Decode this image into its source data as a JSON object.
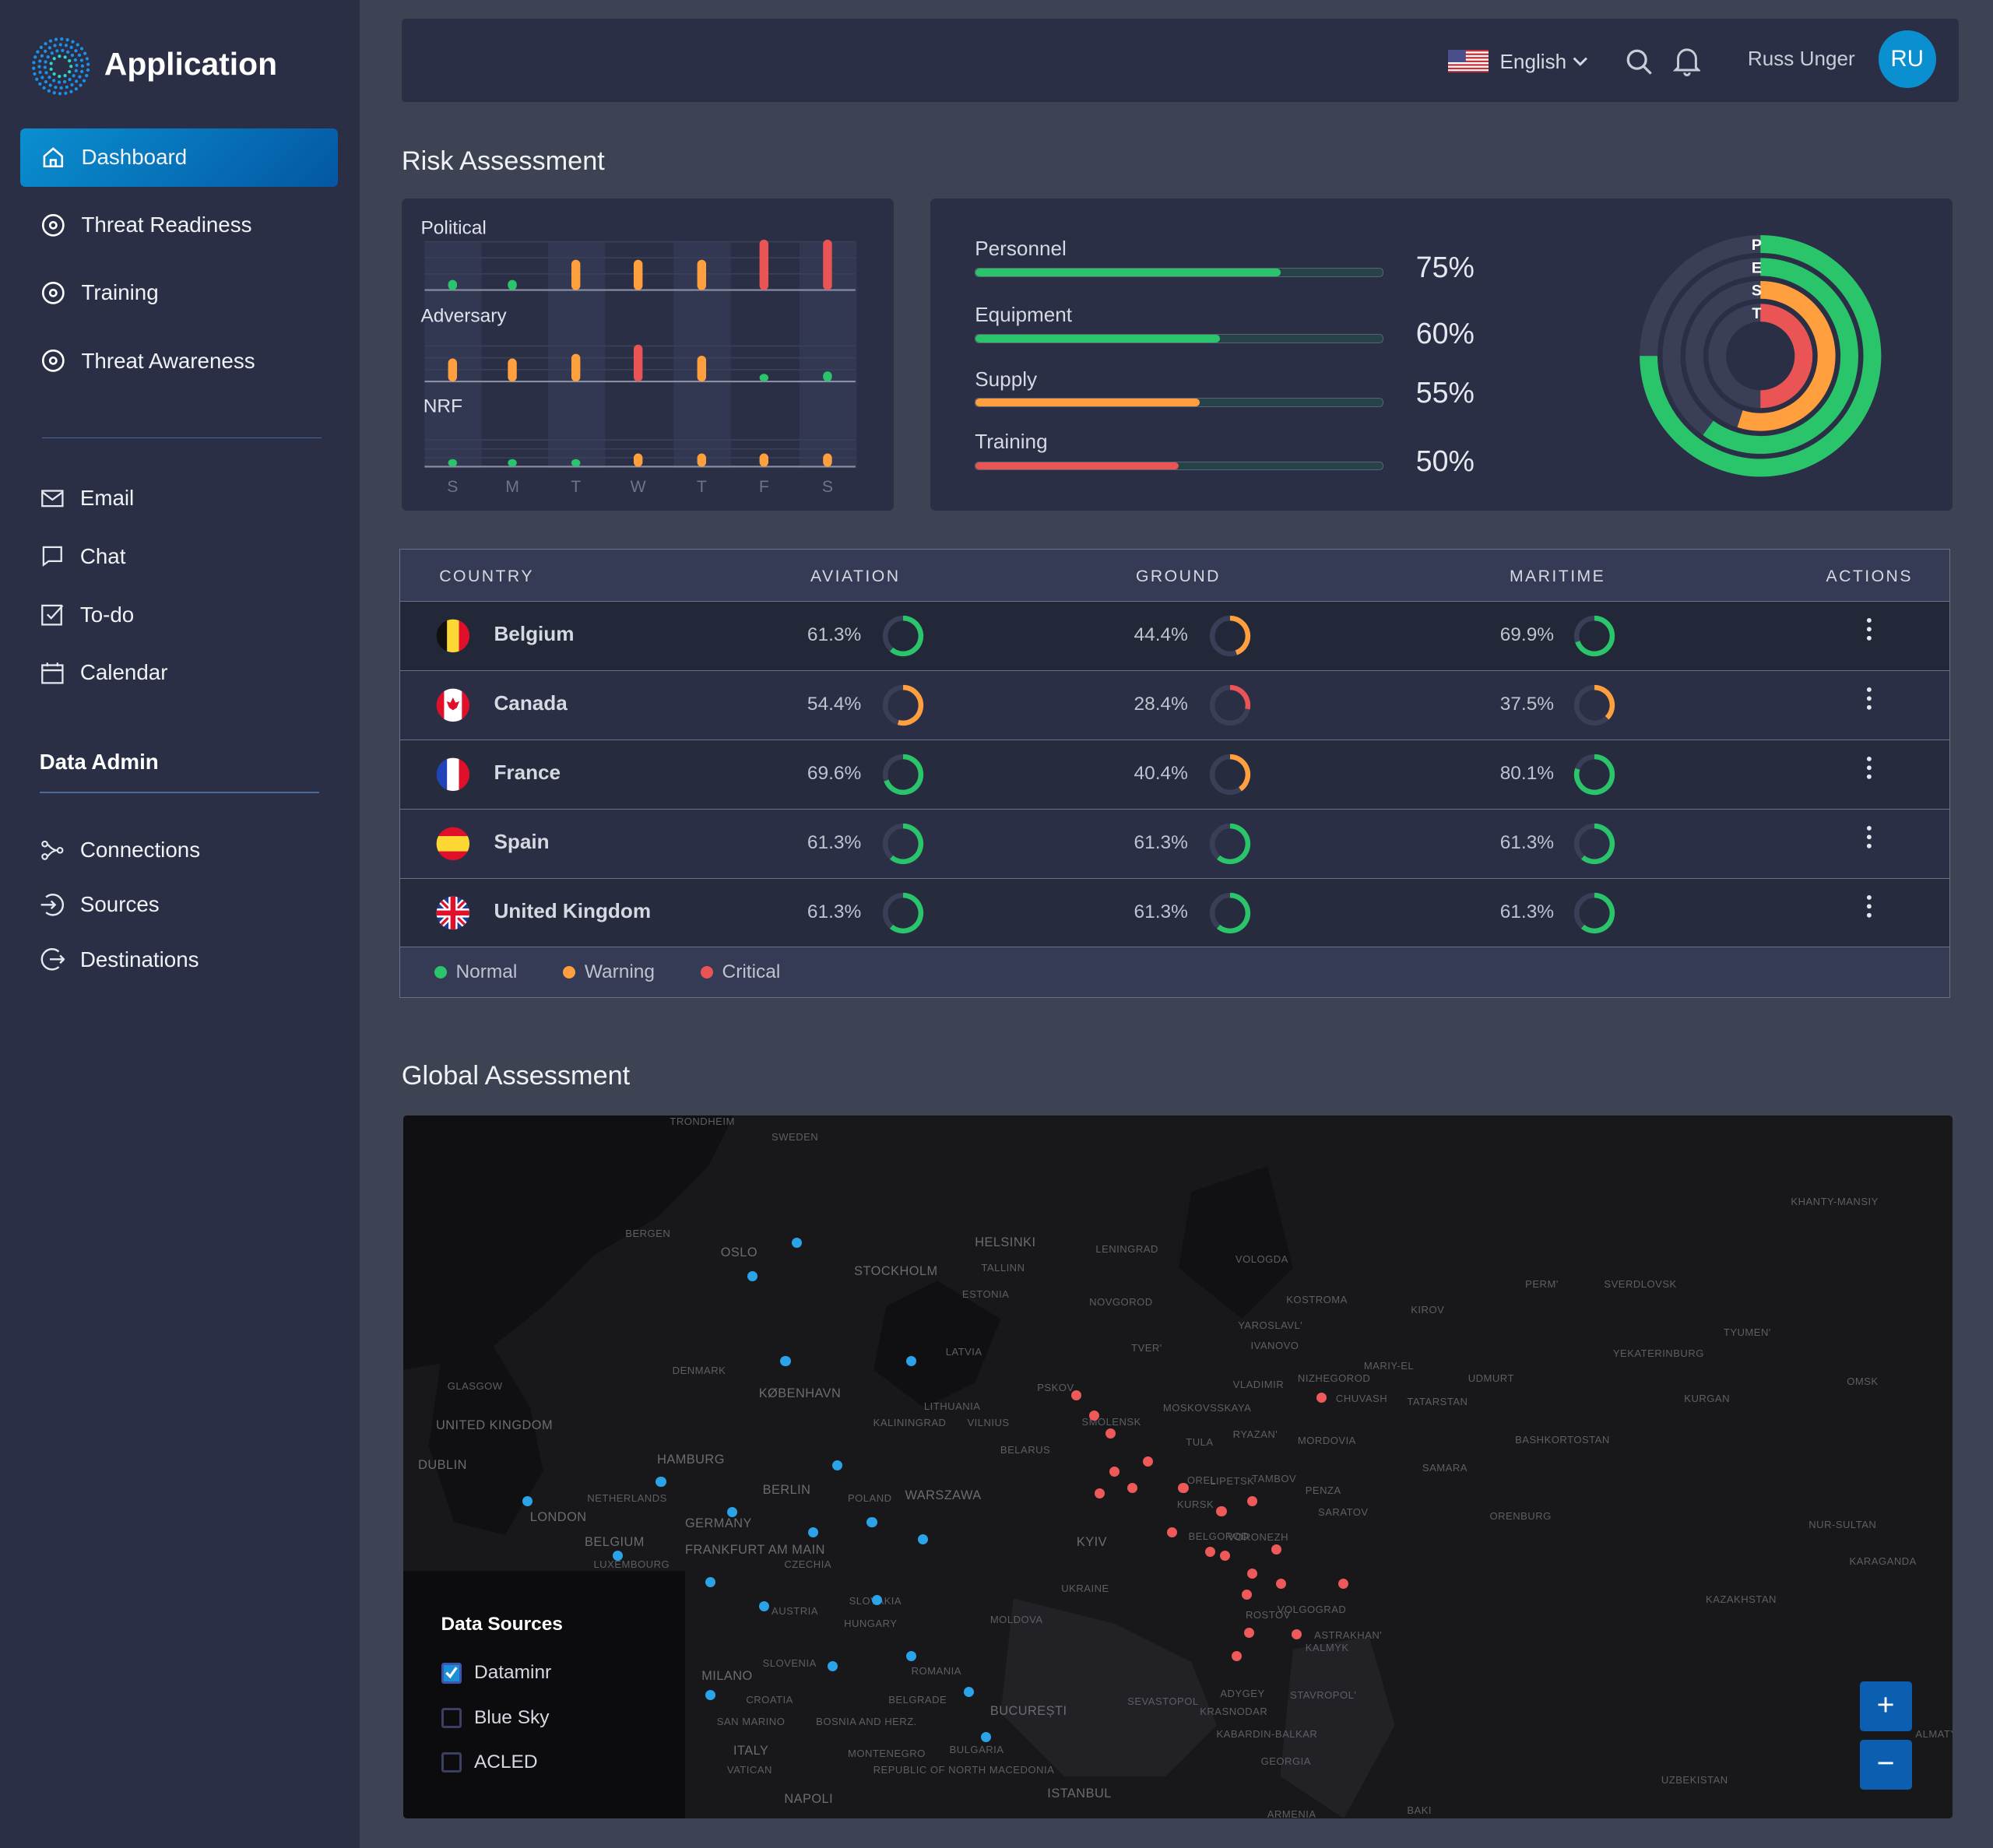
{
  "app": {
    "title": "Application",
    "logo": "dotted-ring-logo"
  },
  "sidebar": {
    "primary": [
      {
        "label": "Dashboard",
        "icon": "home-icon",
        "active": true
      },
      {
        "label": "Threat Readiness",
        "icon": "target-icon"
      },
      {
        "label": "Training",
        "icon": "target-icon"
      },
      {
        "label": "Threat Awareness",
        "icon": "target-icon"
      }
    ],
    "secondary": [
      {
        "label": "Email",
        "icon": "mail-icon"
      },
      {
        "label": "Chat",
        "icon": "chat-icon"
      },
      {
        "label": "To-do",
        "icon": "checkbox-icon"
      },
      {
        "label": "Calendar",
        "icon": "calendar-icon"
      }
    ],
    "data_admin_title": "Data Admin",
    "data_admin": [
      {
        "label": "Connections",
        "icon": "connections-icon"
      },
      {
        "label": "Sources",
        "icon": "sources-icon"
      },
      {
        "label": "Destinations",
        "icon": "destinations-icon"
      }
    ]
  },
  "header": {
    "language": "English",
    "user_name": "Russ Unger",
    "avatar_initials": "RU",
    "accent": "#0a8fd0"
  },
  "risk": {
    "title": "Risk Assessment",
    "days": [
      "S",
      "M",
      "T",
      "W",
      "T",
      "F",
      "S"
    ],
    "mini_charts": [
      {
        "label": "Political",
        "values": [
          1,
          1,
          3,
          3,
          3,
          5,
          5
        ]
      },
      {
        "label": "Adversary",
        "values": [
          2.5,
          2.5,
          3,
          4,
          2.8,
          0.8,
          1.1
        ]
      },
      {
        "label": "NRF",
        "values": [
          1,
          0.8,
          0.8,
          2,
          2,
          2,
          2
        ]
      }
    ],
    "readiness": [
      {
        "label": "Personnel",
        "value": 75,
        "pct": "75%",
        "color": "#2ac56b"
      },
      {
        "label": "Equipment",
        "value": 60,
        "pct": "60%",
        "color": "#2ac56b"
      },
      {
        "label": "Supply",
        "value": 55,
        "pct": "55%",
        "color": "#ff9f3d"
      },
      {
        "label": "Training",
        "value": 50,
        "pct": "50%",
        "color": "#ea5455"
      }
    ],
    "pest": [
      {
        "letter": "P",
        "value": 75,
        "color": "#2ac56b"
      },
      {
        "letter": "E",
        "value": 60,
        "color": "#2ac56b"
      },
      {
        "letter": "S",
        "value": 55,
        "color": "#ff9f3d"
      },
      {
        "letter": "T",
        "value": 50,
        "color": "#ea5455"
      }
    ]
  },
  "table": {
    "headers": [
      "COUNTRY",
      "AVIATION",
      "GROUND",
      "MARITIME",
      "ACTIONS"
    ],
    "rows": [
      {
        "country": "Belgium",
        "flag": "belgium-flag",
        "aviation": "61.3%",
        "ground": "44.4%",
        "maritime": "69.9%"
      },
      {
        "country": "Canada",
        "flag": "canada-flag",
        "aviation": "54.4%",
        "ground": "28.4%",
        "maritime": "37.5%"
      },
      {
        "country": "France",
        "flag": "france-flag",
        "aviation": "69.6%",
        "ground": "40.4%",
        "maritime": "80.1%"
      },
      {
        "country": "Spain",
        "flag": "spain-flag",
        "aviation": "61.3%",
        "ground": "61.3%",
        "maritime": "61.3%"
      },
      {
        "country": "United Kingdom",
        "flag": "uk-flag",
        "aviation": "61.3%",
        "ground": "61.3%",
        "maritime": "61.3%"
      }
    ],
    "legend": [
      {
        "label": "Normal",
        "color": "#2ac56b"
      },
      {
        "label": "Warning",
        "color": "#ff9f3d"
      },
      {
        "label": "Critical",
        "color": "#ea5455"
      }
    ]
  },
  "global": {
    "title": "Global Assessment",
    "map_labels": [
      "TRONDHEIM",
      "SWEDEN",
      "BERGEN",
      "OSLO",
      "STOCKHOLM",
      "HELSINKI",
      "TALLINN",
      "ESTONIA",
      "LENINGRAD",
      "NOVGOROD",
      "VOLOGDA",
      "KOSTROMA",
      "KIROV",
      "PERM'",
      "SVERDLOVSK",
      "KHANTY-MANSIY",
      "TVER'",
      "YAROSLAVL'",
      "IVANOVO",
      "LATVIA",
      "DENMARK",
      "KØBENHAVN",
      "GLASGOW",
      "UNITED KINGDOM",
      "DUBLIN",
      "LITHUANIA",
      "KALININGRAD",
      "VILNIUS",
      "PSKOV",
      "SMOLENSK",
      "MOSKOVSSKAYA",
      "VLADIMIR",
      "NIZHEGOROD",
      "CHUVASH",
      "MARIY-EL",
      "TATARSTAN",
      "UDMURT",
      "YEKATERINBURG",
      "TYUMEN'",
      "OMSK",
      "KURGAN",
      "BASHKORTOSTAN",
      "HAMBURG",
      "BELARUS",
      "TULA",
      "RYAZAN'",
      "MORDOVIA",
      "SAMARA",
      "BERLIN",
      "NETHERLANDS",
      "LONDON",
      "POLAND",
      "WARSZAWA",
      "GERMANY",
      "OREL",
      "LIPETSK",
      "TAMBOV",
      "PENZA",
      "SARATOV",
      "ORENBURG",
      "KURSK",
      "BELGIUM",
      "LUXEMBOURG",
      "FRANKFURT AM MAIN",
      "CZECHIA",
      "KYIV",
      "BELGOROD",
      "VORONEZH",
      "NUR-SULTAN",
      "KARAGANDA",
      "UKRAINE",
      "SLOVAKIA",
      "AUSTRIA",
      "HUNGARY",
      "MOLDOVA",
      "ROSTOV",
      "VOLGOGRAD",
      "ASTRAKHAN'",
      "KALMYK",
      "KAZAKHSTAN",
      "SLOVENIA",
      "ROMANIA",
      "MILANO",
      "CROATIA",
      "BELGRADE",
      "BUCUREȘTI",
      "SEVASTOPOL",
      "ADYGEY",
      "STAVROPOL'",
      "KRASNODAR",
      "SAN MARINO",
      "BOSNIA AND HERZ.",
      "ITALY",
      "MONTENEGRO",
      "BULGARIA",
      "KABARDIN-BALKAR",
      "ALMATY",
      "VATICAN",
      "REPUBLIC OF NORTH MACEDONIA",
      "GEORGIA",
      "UZBEKISTAN",
      "NAPOLI",
      "ISTANBUL",
      "ARMENIA",
      "BAKI"
    ],
    "data_sources_title": "Data Sources",
    "data_sources": [
      {
        "label": "Dataminr",
        "checked": true
      },
      {
        "label": "Blue Sky",
        "checked": false
      },
      {
        "label": "ACLED",
        "checked": false
      }
    ],
    "series_colors": {
      "blue": "#2aa3e8",
      "red": "#ee5a5a"
    },
    "zoom_in": "+",
    "zoom_out": "−"
  }
}
